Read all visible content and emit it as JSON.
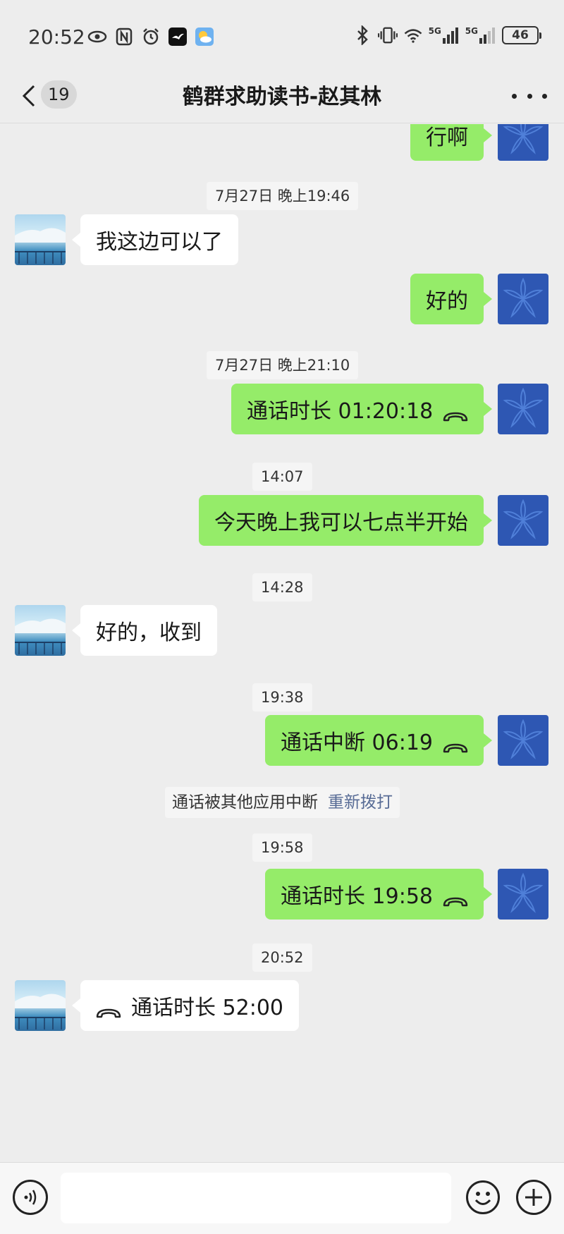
{
  "status_bar": {
    "time": "20:52",
    "left_icons": [
      "eye-icon",
      "nfc-icon",
      "alarm-icon",
      "bird-app-icon",
      "weather-icon"
    ],
    "right_icons": [
      "bluetooth-icon",
      "vibrate-icon",
      "wifi-icon",
      "signal-5g-icon",
      "signal-5g-icon"
    ],
    "net1": "5G",
    "net2": "5G",
    "battery": "46"
  },
  "nav": {
    "unread_count": "19",
    "title": "鹤群求助读书-赵其林"
  },
  "messages": [
    {
      "type": "msg",
      "side": "me",
      "text": "行啊"
    },
    {
      "type": "time",
      "text": "7月27日 晚上19:46"
    },
    {
      "type": "msg",
      "side": "other",
      "text": "我这边可以了"
    },
    {
      "type": "msg",
      "side": "me",
      "text": "好的"
    },
    {
      "type": "time",
      "text": "7月27日 晚上21:10"
    },
    {
      "type": "call",
      "side": "me",
      "text": "通话时长 01:20:18"
    },
    {
      "type": "time",
      "text": "14:07"
    },
    {
      "type": "msg",
      "side": "me",
      "text": "今天晚上我可以七点半开始"
    },
    {
      "type": "time",
      "text": "14:28"
    },
    {
      "type": "msg",
      "side": "other",
      "text": "好的，收到"
    },
    {
      "type": "time",
      "text": "19:38"
    },
    {
      "type": "call",
      "side": "me",
      "text": "通话中断 06:19"
    },
    {
      "type": "system",
      "text": "通话被其他应用中断",
      "link": "重新拨打"
    },
    {
      "type": "time",
      "text": "19:58"
    },
    {
      "type": "call",
      "side": "me",
      "text": "通话时长 19:58"
    },
    {
      "type": "time",
      "text": "20:52"
    },
    {
      "type": "call",
      "side": "other",
      "text": "通话时长 52:00"
    }
  ],
  "input": {
    "value": "",
    "placeholder": ""
  },
  "colors": {
    "background": "#ededed",
    "bubble_me": "#95ec69",
    "bubble_other": "#ffffff",
    "avatar_me": "#2e57b3",
    "link": "#576b95"
  }
}
